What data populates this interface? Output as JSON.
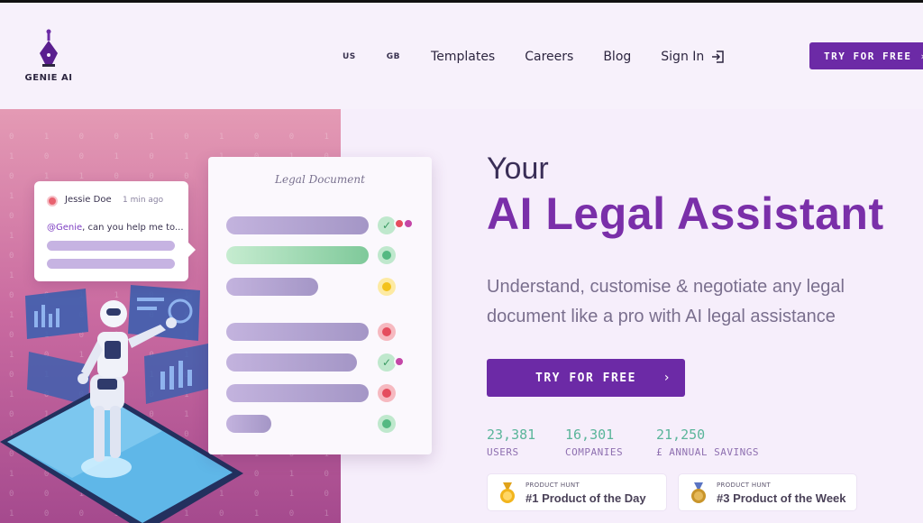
{
  "header": {
    "logo_text": "GENIE AI",
    "nav": {
      "flag_us": "US",
      "flag_gb": "GB",
      "templates": "Templates",
      "careers": "Careers",
      "blog": "Blog",
      "signin": "Sign In"
    },
    "cta_label": "TRY FOR FREE"
  },
  "illustration": {
    "chat": {
      "name": "Jessie Doe",
      "time": "1 min ago",
      "mention": "@Genie",
      "message": ", can you help me to..."
    },
    "document_title": "Legal Document"
  },
  "hero": {
    "pretitle": "Your",
    "title": "AI Legal Assistant",
    "subtitle": "Understand, customise & negotiate any legal document like a pro with AI legal assistance",
    "cta_label": "TRY FOR FREE"
  },
  "stats": [
    {
      "value": "23,381",
      "label": "USERS"
    },
    {
      "value": "16,301",
      "label": "COMPANIES"
    },
    {
      "value": "21,250",
      "label": "£ ANNUAL SAVINGS"
    }
  ],
  "badges": [
    {
      "source": "PRODUCT HUNT",
      "rank": "#1 Product of the Day"
    },
    {
      "source": "PRODUCT HUNT",
      "rank": "#3 Product of the Week"
    }
  ],
  "colors": {
    "accent": "#6c2aa6",
    "title": "#7a2fa9",
    "stat_number": "#5ab59a",
    "background": "#f6eefb"
  }
}
